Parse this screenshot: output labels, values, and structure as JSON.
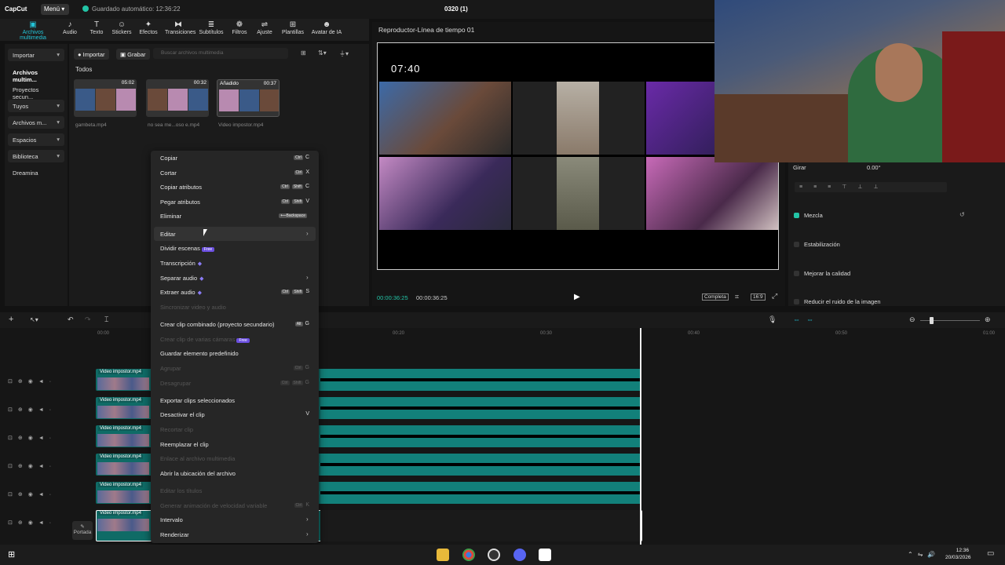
{
  "app": {
    "logo": "CapCut",
    "menu": "Menú",
    "autosave": "Guardado automático: 12:36:22",
    "project": "0320 (1)"
  },
  "tools": [
    {
      "label": "Archivos multimedia",
      "icon": "media-icon"
    },
    {
      "label": "Audio",
      "icon": "audio-icon"
    },
    {
      "label": "Texto",
      "icon": "text-icon"
    },
    {
      "label": "Stickers",
      "icon": "sticker-icon"
    },
    {
      "label": "Efectos",
      "icon": "effects-icon"
    },
    {
      "label": "Transiciones",
      "icon": "transition-icon"
    },
    {
      "label": "Subtítulos",
      "icon": "caption-icon"
    },
    {
      "label": "Filtros",
      "icon": "filter-icon"
    },
    {
      "label": "Ajuste",
      "icon": "adjust-icon"
    },
    {
      "label": "Plantillas",
      "icon": "template-icon"
    },
    {
      "label": "Avatar de IA",
      "icon": "avatar-icon"
    }
  ],
  "nav": [
    "Importar",
    "Archivos multim...",
    "Proyectos secun...",
    "Tuyos",
    "Archivos m...",
    "Espacios",
    "Biblioteca",
    "Dreamina"
  ],
  "media": {
    "import": "Importar",
    "record": "Grabar",
    "search_placeholder": "Buscar archivos multimedia",
    "section": "Todos",
    "items": [
      {
        "name": "gambeta.mp4",
        "duration": "05:02",
        "tag": ""
      },
      {
        "name": "no sea me...oso e.mp4",
        "duration": "00:32",
        "tag": ""
      },
      {
        "name": "Video impostor.mp4",
        "duration": "00:37",
        "tag": "Añadido"
      }
    ]
  },
  "player": {
    "title": "Reproductor-Línea de tiempo 01",
    "clock": "07:40",
    "current": "00:00:36:25",
    "total": "00:00:36:25",
    "full": "Completa",
    "ratio": "16:9"
  },
  "props": {
    "rotate_label": "Girar",
    "rotate_value": "0.00°",
    "blend": "Mezcla",
    "stabilize": "Estabilización",
    "improve": "Mejorar la calidad",
    "denoise": "Reducir el ruido de la imagen"
  },
  "timeline": {
    "ruler": [
      "00:00",
      "00:10",
      "00:20",
      "00:30",
      "00:40",
      "00:50",
      "01:00"
    ],
    "clip_label": "Video impostor.mp4",
    "cover": "Portada"
  },
  "context_menu": [
    {
      "label": "Copiar",
      "keys": [
        "Ctrl"
      ],
      "key": "C",
      "disabled": false
    },
    {
      "label": "Cortar",
      "keys": [
        "Ctrl"
      ],
      "key": "X",
      "disabled": false
    },
    {
      "label": "Copiar atributos",
      "keys": [
        "Ctrl",
        "Shift"
      ],
      "key": "C",
      "disabled": false
    },
    {
      "label": "Pegar atributos",
      "keys": [
        "Ctrl",
        "Shift"
      ],
      "key": "V",
      "disabled": false
    },
    {
      "label": "Eliminar",
      "keys": [
        "⟵Backspace"
      ],
      "key": "",
      "disabled": false
    },
    {
      "label": "Editar",
      "keys": [],
      "key": "",
      "disabled": false,
      "submenu": true
    },
    {
      "label": "Dividir escenas",
      "keys": [],
      "key": "",
      "disabled": false,
      "free": "Free"
    },
    {
      "label": "Transcripción",
      "keys": [],
      "key": "",
      "disabled": false,
      "gem": true
    },
    {
      "label": "Separar audio",
      "keys": [],
      "key": "",
      "disabled": false,
      "gem": true,
      "submenu": true
    },
    {
      "label": "Extraer audio",
      "keys": [
        "Ctrl",
        "Shift"
      ],
      "key": "S",
      "disabled": false,
      "gem": true
    },
    {
      "label": "Sincronizar video y audio",
      "keys": [],
      "key": "",
      "disabled": true
    },
    {
      "label": "Crear clip combinado (proyecto secundario)",
      "keys": [
        "Alt"
      ],
      "key": "G",
      "disabled": false
    },
    {
      "label": "Crear clip de varias cámaras",
      "keys": [],
      "key": "",
      "disabled": true,
      "free": "Free"
    },
    {
      "label": "Guardar elemento predefinido",
      "keys": [],
      "key": "",
      "disabled": false
    },
    {
      "label": "Agrupar",
      "keys": [
        "Ctrl"
      ],
      "key": "G",
      "disabled": true
    },
    {
      "label": "Desagrupar",
      "keys": [
        "Ctrl",
        "Shift"
      ],
      "key": "G",
      "disabled": true
    },
    {
      "label": "Exportar clips seleccionados",
      "keys": [],
      "key": "",
      "disabled": false
    },
    {
      "label": "Desactivar el clip",
      "keys": [],
      "key": "V",
      "disabled": false
    },
    {
      "label": "Recortar clip",
      "keys": [],
      "key": "",
      "disabled": true
    },
    {
      "label": "Reemplazar el clip",
      "keys": [],
      "key": "",
      "disabled": false
    },
    {
      "label": "Enlace al archivo multimedia",
      "keys": [],
      "key": "",
      "disabled": true
    },
    {
      "label": "Abrir la ubicación del archivo",
      "keys": [],
      "key": "",
      "disabled": false
    },
    {
      "label": "Editar los títulos",
      "keys": [],
      "key": "",
      "disabled": true
    },
    {
      "label": "Generar animación de velocidad variable",
      "keys": [
        "Ctrl"
      ],
      "key": "K",
      "disabled": true
    },
    {
      "label": "Intervalo",
      "keys": [],
      "key": "",
      "disabled": false,
      "submenu": true
    },
    {
      "label": "Renderizar",
      "keys": [],
      "key": "",
      "disabled": false,
      "submenu": true
    }
  ],
  "taskbar": {
    "time": "12:36",
    "date": "20/03/2026"
  }
}
